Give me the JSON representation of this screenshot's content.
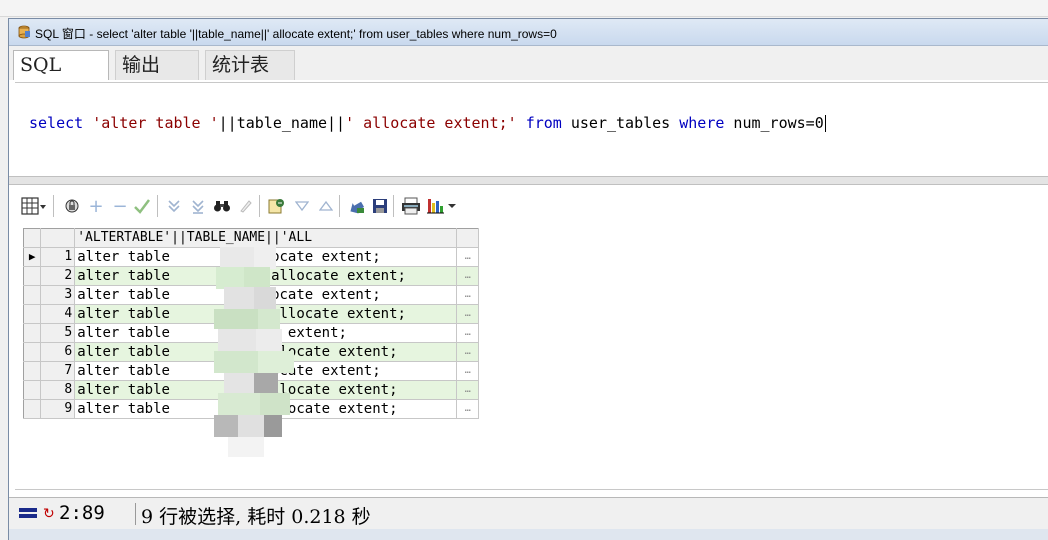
{
  "window": {
    "title": "SQL 窗口 - select 'alter table '||table_name||' allocate extent;' from user_tables where num_rows=0"
  },
  "tabs": [
    {
      "label": "SQL",
      "active": true
    },
    {
      "label": "输出",
      "active": false
    },
    {
      "label": "统计表",
      "active": false
    }
  ],
  "editor": {
    "tokens": [
      {
        "text": "select",
        "type": "kw"
      },
      {
        "text": " ",
        "type": "id"
      },
      {
        "text": "'alter table '",
        "type": "str"
      },
      {
        "text": "||table_name||",
        "type": "id"
      },
      {
        "text": "' allocate extent;'",
        "type": "str"
      },
      {
        "text": " ",
        "type": "id"
      },
      {
        "text": "from",
        "type": "kw"
      },
      {
        "text": " user_tables ",
        "type": "id"
      },
      {
        "text": "where",
        "type": "kw"
      },
      {
        "text": " num_rows=0",
        "type": "id"
      }
    ]
  },
  "toolbar": {
    "icons": [
      "grid-menu-icon",
      "lock-icon",
      "add-record-icon",
      "delete-record-icon",
      "post-check-icon",
      "query-down-icon",
      "query-all-icon",
      "find-binoculars-icon",
      "clear-icon",
      "export-icon",
      "filter-down-icon",
      "filter-up-icon",
      "fetch-icon",
      "save-icon",
      "print-icon",
      "chart-icon"
    ]
  },
  "grid": {
    "column_header": "'ALTERTABLE'||TABLE_NAME||'ALL",
    "ellipsis": "…",
    "rows": [
      {
        "num": "1",
        "text": "alter table          llocate extent;",
        "current": true
      },
      {
        "num": "2",
        "text": "alter table          R allocate extent;",
        "current": false
      },
      {
        "num": "3",
        "text": "alter table          llocate extent;",
        "current": false
      },
      {
        "num": "4",
        "text": "alter table          Z allocate extent;",
        "current": false
      },
      {
        "num": "5",
        "text": "alter table         cate extent;",
        "current": false
      },
      {
        "num": "6",
        "text": "alter table           allocate extent;",
        "current": false
      },
      {
        "num": "7",
        "text": "alter table          llocate extent;",
        "current": false
      },
      {
        "num": "8",
        "text": "alter table           allocate extent;",
        "current": false
      },
      {
        "num": "9",
        "text": "alter table           allocate extent;",
        "current": false
      }
    ]
  },
  "status": {
    "position": "2:89",
    "message": "9 行被选择, 耗时 0.218 秒"
  }
}
